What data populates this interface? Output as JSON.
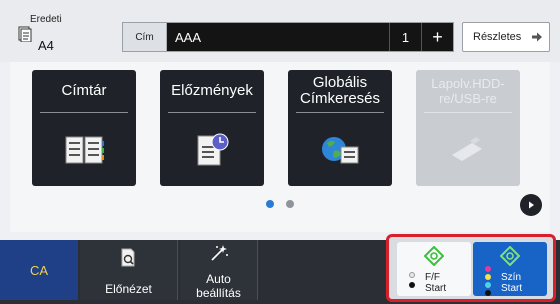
{
  "original": {
    "label": "Eredeti",
    "size": "A4"
  },
  "address": {
    "label": "Cím",
    "value": "AAA",
    "count": "1",
    "plus": "+"
  },
  "details": {
    "label": "Részletes"
  },
  "tiles": [
    {
      "title": "Címtár",
      "icon": "address-book-icon"
    },
    {
      "title": "Előzmények",
      "icon": "history-icon"
    },
    {
      "title": "Globális Címkeresés",
      "icon": "global-address-search-icon"
    },
    {
      "title": "Lapolv.HDD-re/USB-re",
      "icon": "hdd-usb-icon",
      "disabled": true
    }
  ],
  "pager": {
    "pages": 2,
    "active": 1
  },
  "bottom": {
    "ca": "CA",
    "preview": "Előnézet",
    "auto_line1": "Auto",
    "auto_line2": "beállítás"
  },
  "start": {
    "bw_line1": "F/F",
    "bw_line2": "Start",
    "color_line1": "Szín",
    "color_line2": "Start"
  },
  "colors": {
    "tile_bg": "#1f2329",
    "accent_blue": "#1764c6",
    "highlight_red": "#d8202a",
    "ca_bg": "#1f3f86",
    "ca_text": "#f0d24a",
    "start_green": "#3cbf3c"
  }
}
